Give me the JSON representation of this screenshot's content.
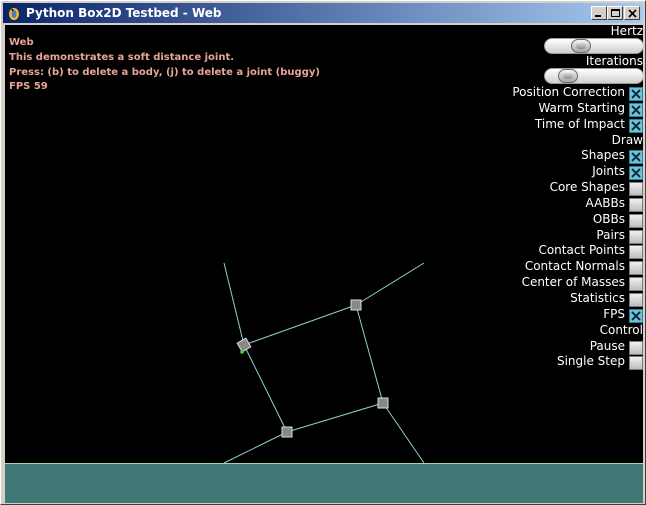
{
  "window": {
    "title": "Python Box2D Testbed - Web",
    "icon": "pygame-snake-icon",
    "controls": [
      "minimize-icon",
      "maximize-icon",
      "close-icon"
    ]
  },
  "info": {
    "line1": "Web",
    "line2": "This demonstrates a soft distance joint.",
    "line3": "Press: (b) to delete a body, (j) to delete a joint (buggy)",
    "line4": "FPS 59"
  },
  "gui": {
    "hertz_label": "Hertz",
    "hertz_value": 0.33,
    "iterations_label": "Iterations",
    "iterations_value": 0.17,
    "options": [
      {
        "label": "Position Correction",
        "checked": true
      },
      {
        "label": "Warm Starting",
        "checked": true
      },
      {
        "label": "Time of Impact",
        "checked": true
      }
    ],
    "draw_header": "Draw",
    "draw_options": [
      {
        "label": "Shapes",
        "checked": true
      },
      {
        "label": "Joints",
        "checked": true
      },
      {
        "label": "Core Shapes",
        "checked": false
      },
      {
        "label": "AABBs",
        "checked": false
      },
      {
        "label": "OBBs",
        "checked": false
      },
      {
        "label": "Pairs",
        "checked": false
      },
      {
        "label": "Contact Points",
        "checked": false
      },
      {
        "label": "Contact Normals",
        "checked": false
      },
      {
        "label": "Center of Masses",
        "checked": false
      },
      {
        "label": "Statistics",
        "checked": false
      },
      {
        "label": "FPS",
        "checked": true
      }
    ],
    "control_header": "Control",
    "control_options": [
      {
        "label": "Pause",
        "checked": false
      },
      {
        "label": "Single Step",
        "checked": false
      }
    ]
  },
  "colors": {
    "background": "#000000",
    "info_text": "#e8a596",
    "ground": "#3f7774",
    "joint": "#8fd3c8",
    "body": "#888888",
    "checkbox_on": "#6fc3d6"
  }
}
